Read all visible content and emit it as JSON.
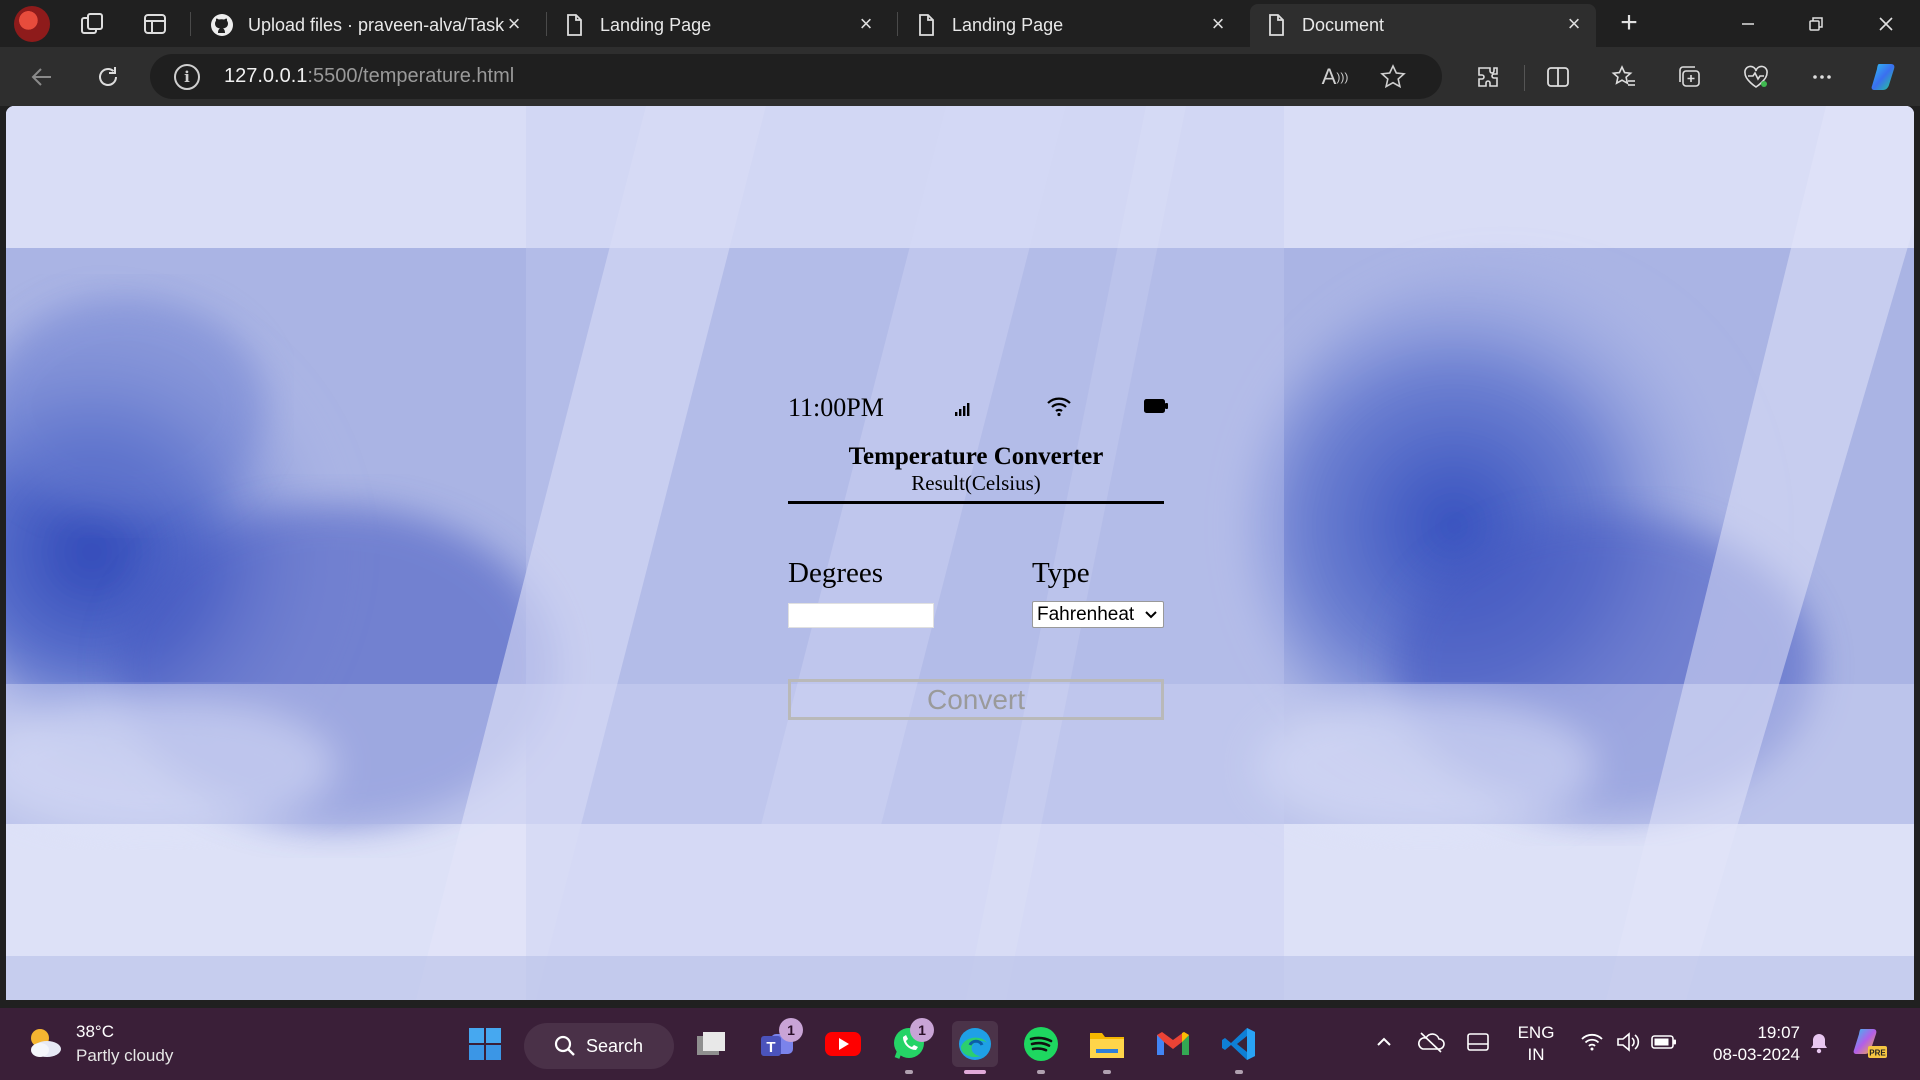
{
  "browser": {
    "tabs": [
      {
        "title": "Upload files · praveen-alva/Task",
        "icon": "github-icon"
      },
      {
        "title": "Landing Page",
        "icon": "page-icon"
      },
      {
        "title": "Landing Page",
        "icon": "page-icon"
      },
      {
        "title": "Document",
        "icon": "page-icon",
        "active": true
      }
    ],
    "url_host": "127.0.0.1",
    "url_path": ":5500/temperature.html",
    "read_aloud_label": "A"
  },
  "app": {
    "status_time": "11:00PM",
    "title": "Temperature Converter",
    "subtitle": "Result(Celsius)",
    "degrees_label": "Degrees",
    "degrees_value": "",
    "type_label": "Type",
    "type_selected": "Fahrenheat",
    "convert_label": "Convert"
  },
  "taskbar": {
    "weather_temp": "38°C",
    "weather_desc": "Partly cloudy",
    "search_label": "Search",
    "teams_badge": "1",
    "whatsapp_badge": "1",
    "lang_line1": "ENG",
    "lang_line2": "IN",
    "time": "19:07",
    "date": "08-03-2024"
  },
  "colors": {
    "page_bg": "#c7cdee",
    "cloud_blue": "#2d45b8",
    "taskbar_bg": "#3a1f38",
    "chrome_bg": "#202020"
  }
}
